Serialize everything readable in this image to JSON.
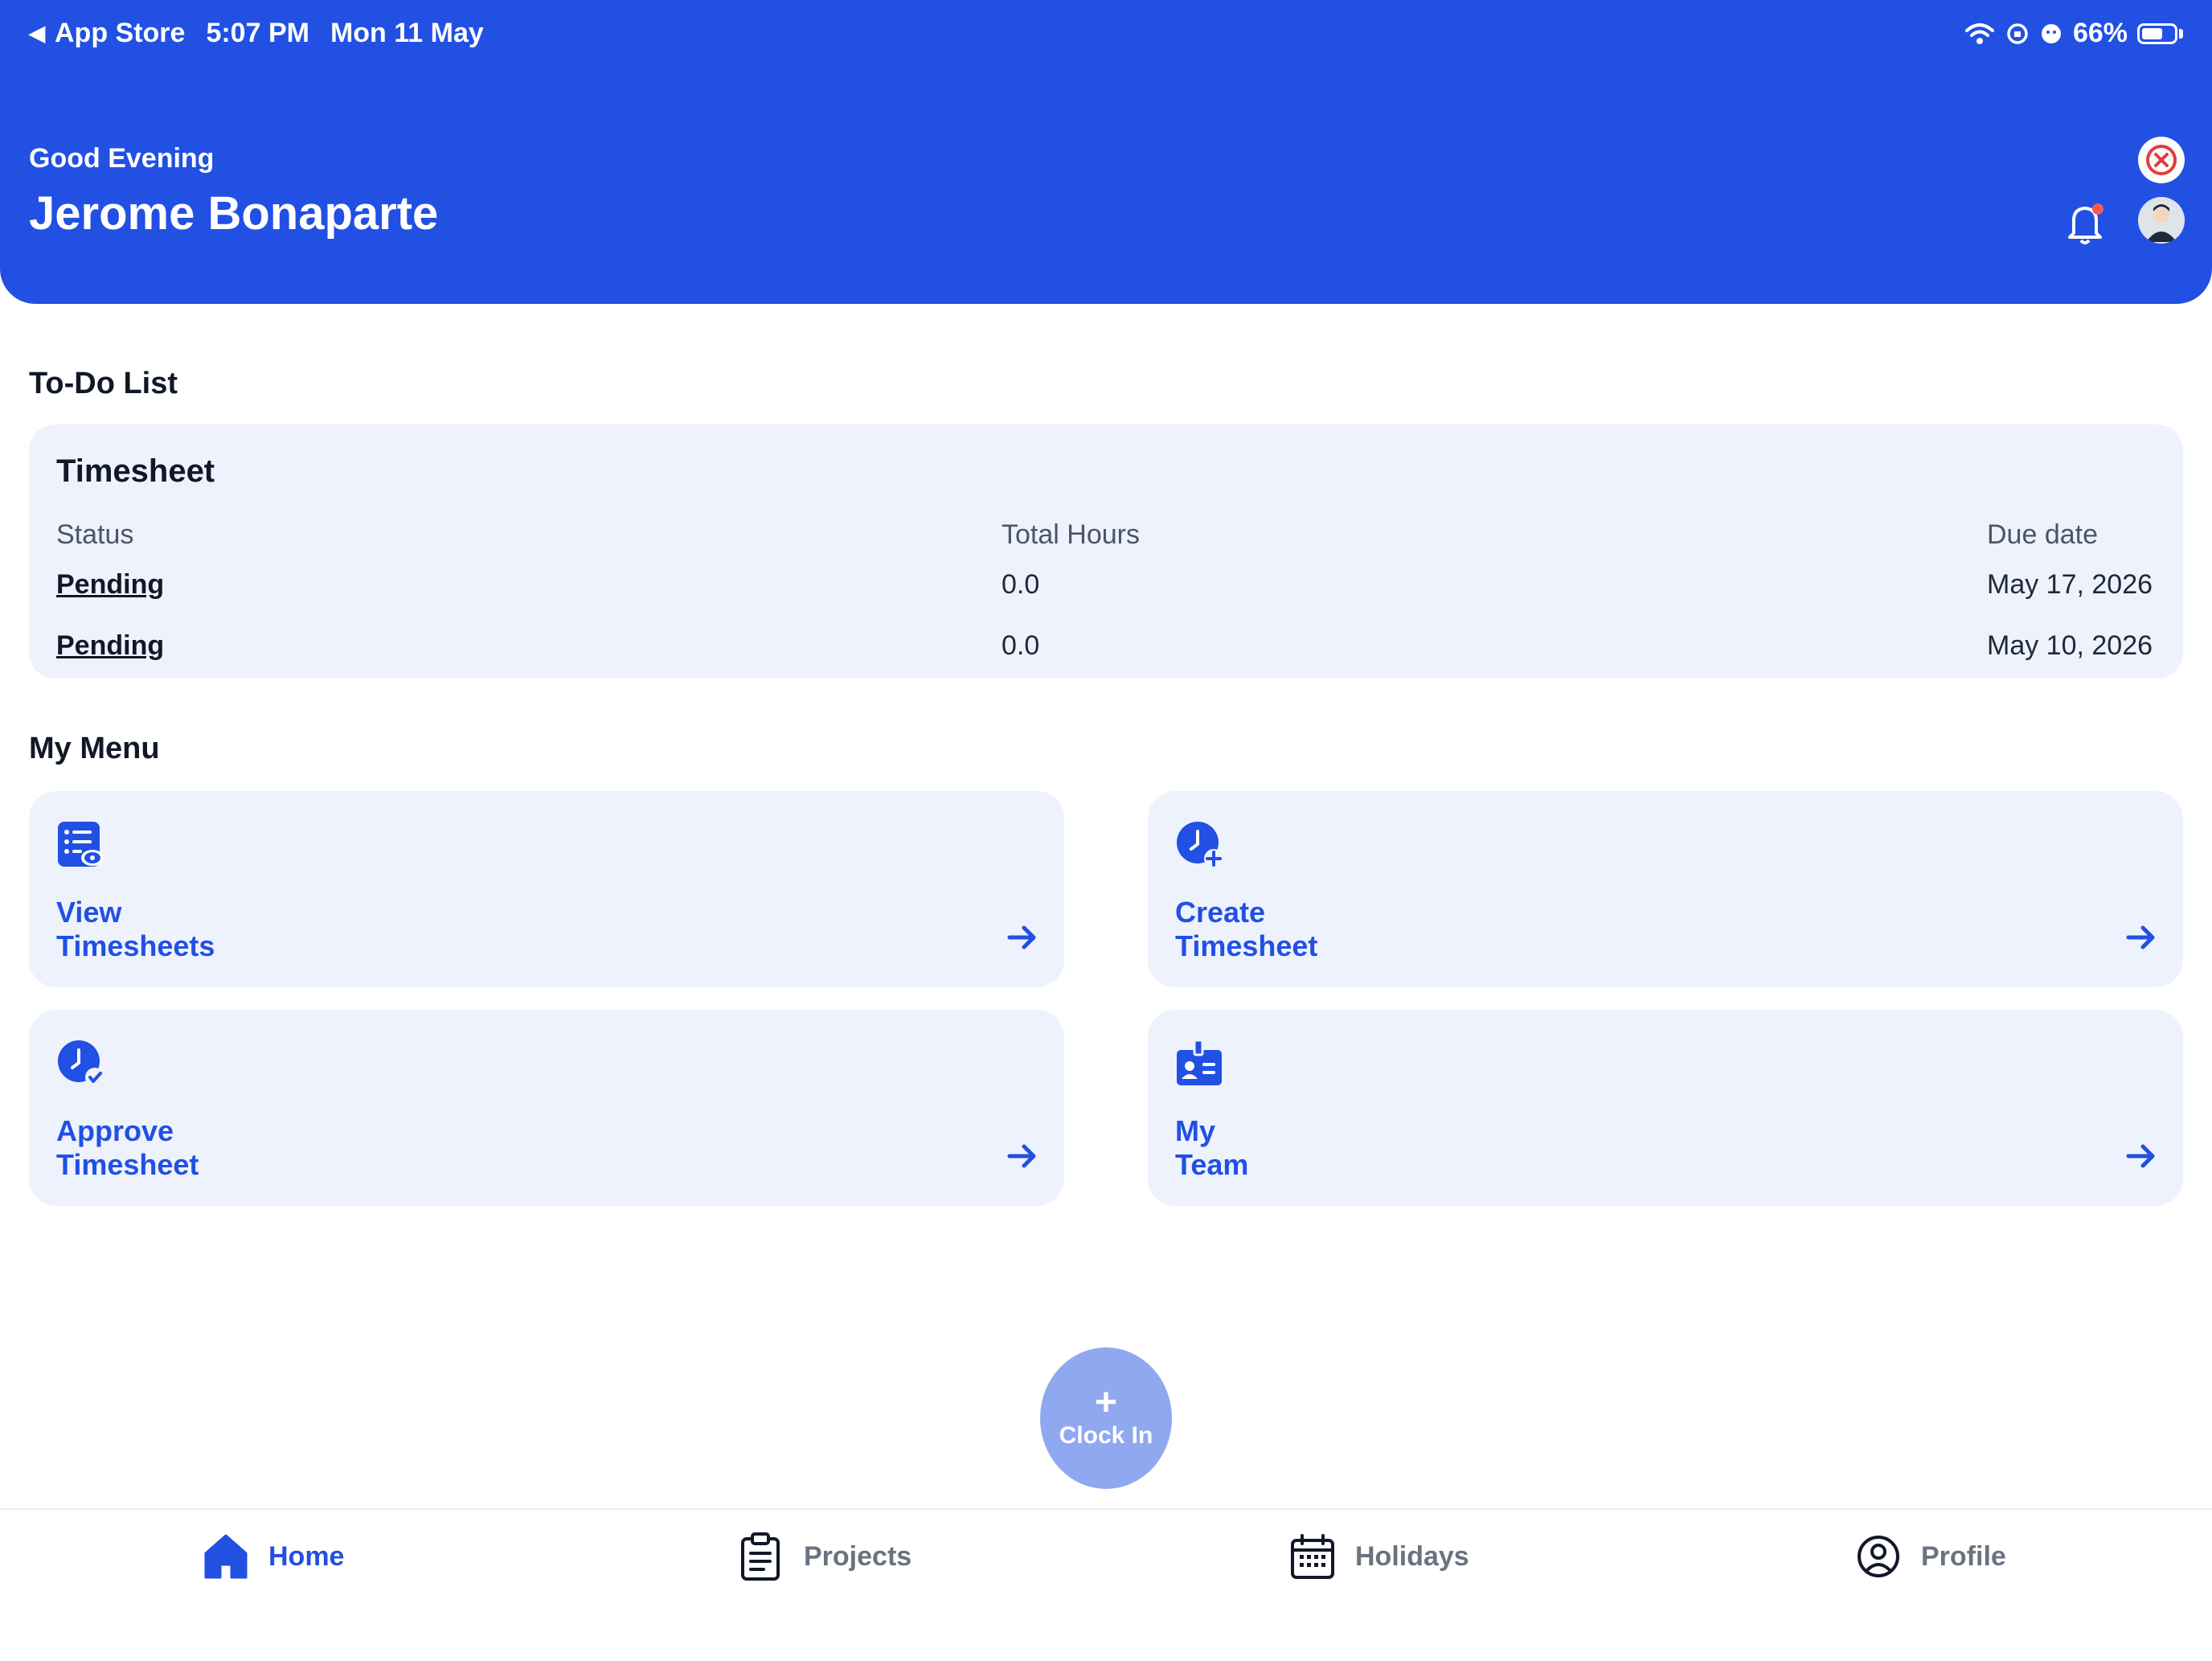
{
  "status_bar": {
    "back_label": "App Store",
    "time": "5:07 PM",
    "date": "Mon 11 May",
    "battery_percent": "66%",
    "battery_level": 0.66
  },
  "header": {
    "greeting": "Good Evening",
    "user_name": "Jerome Bonaparte",
    "icons": [
      "close-circle-icon",
      "bell-icon",
      "avatar"
    ]
  },
  "todo": {
    "section_title": "To-Do List",
    "card_title": "Timesheet",
    "columns": [
      "Status",
      "Total Hours",
      "Due date"
    ],
    "rows": [
      {
        "status": "Pending",
        "hours": "0.0",
        "due": "May 17, 2026"
      },
      {
        "status": "Pending",
        "hours": "0.0",
        "due": "May 10, 2026"
      }
    ]
  },
  "menu": {
    "section_title": "My Menu",
    "items": [
      {
        "line1": "View",
        "line2": "Timesheets",
        "icon": "list-view-icon"
      },
      {
        "line1": "Create",
        "line2": "Timesheet",
        "icon": "clock-plus-icon"
      },
      {
        "line1": "Approve",
        "line2": "Timesheet",
        "icon": "clock-check-icon"
      },
      {
        "line1": "My",
        "line2": "Team",
        "icon": "id-badge-icon"
      }
    ]
  },
  "clock_in": {
    "label": "Clock In"
  },
  "bottom_nav": {
    "items": [
      {
        "label": "Home",
        "icon": "home-icon",
        "active": true
      },
      {
        "label": "Projects",
        "icon": "clipboard-icon",
        "active": false
      },
      {
        "label": "Holidays",
        "icon": "calendar-icon",
        "active": false
      },
      {
        "label": "Profile",
        "icon": "user-circle-icon",
        "active": false
      }
    ]
  },
  "colors": {
    "primary": "#2150e3",
    "card_bg": "#eef2fc",
    "clockin_bg": "#8fa8f0"
  }
}
